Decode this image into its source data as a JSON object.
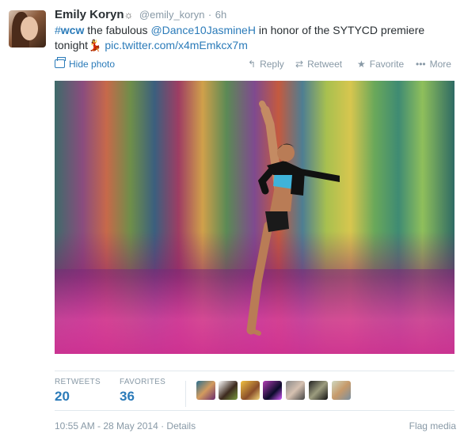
{
  "tweet": {
    "fullname": "Emily Koryn",
    "name_symbol": "☼",
    "username": "@emily_koryn",
    "separator": "·",
    "time_ago": "6h",
    "text_parts": {
      "hashtag_symbol": "#",
      "hashtag": "wcw",
      "text1": " the fabulous ",
      "mention": "@Dance10JasmineH",
      "text2": " in honor of the SYTYCD premiere tonight",
      "emoji": "💃",
      "pic_link": "pic.twitter.com/x4mEmkcx7m"
    }
  },
  "actions": {
    "hide_photo": "Hide photo",
    "reply": "Reply",
    "retweet": "Retweet",
    "favorite": "Favorite",
    "more": "More"
  },
  "icons": {
    "photo": "photo-icon",
    "reply": "reply-icon",
    "retweet": "retweet-icon",
    "favorite": "star-icon",
    "more": "more-dots-icon"
  },
  "stats": {
    "retweets_label": "RETWEETS",
    "retweets_count": "20",
    "favorites_label": "FAVORITES",
    "favorites_count": "36"
  },
  "favoriters_count_shown": 7,
  "footer": {
    "datetime": "10:55 AM - 28 May 2014",
    "separator": " · ",
    "details": "Details",
    "flag_media": "Flag media"
  },
  "colors": {
    "link": "#2b7bb9",
    "muted": "#8899a6",
    "text": "#292f33",
    "divider": "#e1e8ed"
  }
}
